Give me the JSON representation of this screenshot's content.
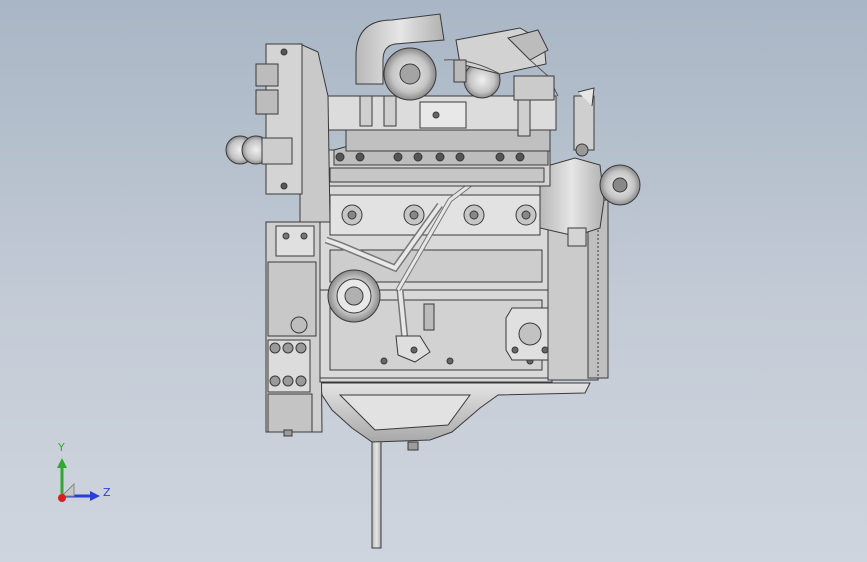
{
  "viewport": {
    "background_top": "#a9b6c5",
    "background_bottom": "#cfd5de"
  },
  "model": {
    "part_color": "#d8d8d8",
    "edge_color": "#3a3a3a"
  },
  "triad": {
    "y_label": "Y",
    "z_label": "Z",
    "y_color": "#2faa2f",
    "z_color": "#2a3fd8",
    "x_color": "#d42020",
    "icons": [
      "y-axis-arrow-icon",
      "z-axis-arrow-icon",
      "x-axis-origin-icon"
    ]
  }
}
